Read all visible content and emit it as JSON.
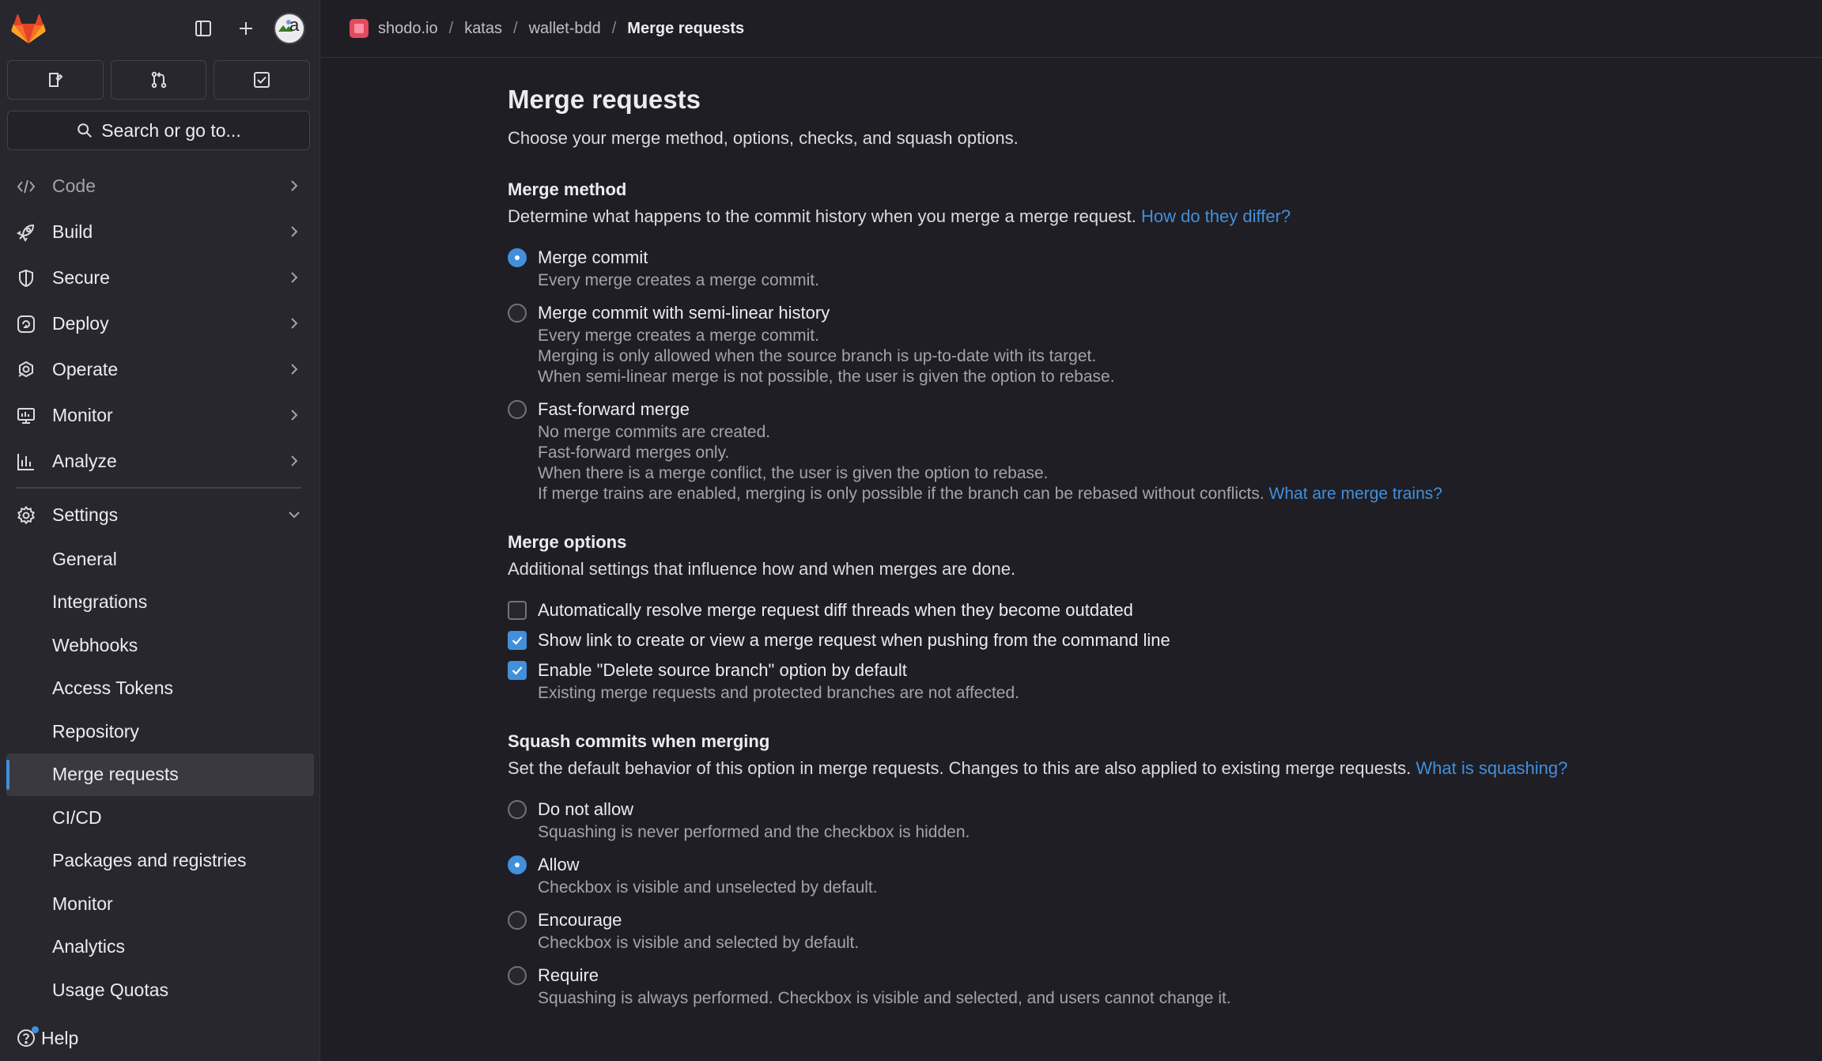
{
  "sidebar": {
    "avatar_alt": "a",
    "search_label": "Search or go to...",
    "nav": [
      {
        "label": "Code",
        "icon": "code-icon"
      },
      {
        "label": "Build",
        "icon": "rocket-icon"
      },
      {
        "label": "Secure",
        "icon": "shield-icon"
      },
      {
        "label": "Deploy",
        "icon": "deploy-icon"
      },
      {
        "label": "Operate",
        "icon": "operate-icon"
      },
      {
        "label": "Monitor",
        "icon": "monitor-icon"
      },
      {
        "label": "Analyze",
        "icon": "chart-icon"
      }
    ],
    "settings_label": "Settings",
    "settings_items": [
      "General",
      "Integrations",
      "Webhooks",
      "Access Tokens",
      "Repository",
      "Merge requests",
      "CI/CD",
      "Packages and registries",
      "Monitor",
      "Analytics",
      "Usage Quotas"
    ],
    "active_item": "Merge requests",
    "help_label": "Help"
  },
  "breadcrumb": [
    "shodo.io",
    "katas",
    "wallet-bdd",
    "Merge requests"
  ],
  "page": {
    "title": "Merge requests",
    "description": "Choose your merge method, options, checks, and squash options."
  },
  "merge_method": {
    "title": "Merge method",
    "description": "Determine what happens to the commit history when you merge a merge request.",
    "link": "How do they differ?",
    "options": [
      {
        "label": "Merge commit",
        "selected": true,
        "help": [
          "Every merge creates a merge commit."
        ]
      },
      {
        "label": "Merge commit with semi-linear history",
        "selected": false,
        "help": [
          "Every merge creates a merge commit.",
          "Merging is only allowed when the source branch is up-to-date with its target.",
          "When semi-linear merge is not possible, the user is given the option to rebase."
        ]
      },
      {
        "label": "Fast-forward merge",
        "selected": false,
        "help": [
          "No merge commits are created.",
          "Fast-forward merges only.",
          "When there is a merge conflict, the user is given the option to rebase.",
          "If merge trains are enabled, merging is only possible if the branch can be rebased without conflicts."
        ],
        "link": "What are merge trains?"
      }
    ]
  },
  "merge_options": {
    "title": "Merge options",
    "description": "Additional settings that influence how and when merges are done.",
    "options": [
      {
        "label": "Automatically resolve merge request diff threads when they become outdated",
        "checked": false
      },
      {
        "label": "Show link to create or view a merge request when pushing from the command line",
        "checked": true
      },
      {
        "label": "Enable \"Delete source branch\" option by default",
        "checked": true,
        "help": "Existing merge requests and protected branches are not affected."
      }
    ]
  },
  "squash": {
    "title": "Squash commits when merging",
    "description": "Set the default behavior of this option in merge requests. Changes to this are also applied to existing merge requests.",
    "link": "What is squashing?",
    "options": [
      {
        "label": "Do not allow",
        "selected": false,
        "help": "Squashing is never performed and the checkbox is hidden."
      },
      {
        "label": "Allow",
        "selected": true,
        "help": "Checkbox is visible and unselected by default."
      },
      {
        "label": "Encourage",
        "selected": false,
        "help": "Checkbox is visible and selected by default."
      },
      {
        "label": "Require",
        "selected": false,
        "help": "Squashing is always performed. Checkbox is visible and selected, and users cannot change it."
      }
    ]
  },
  "colors": {
    "accent": "#428fdc",
    "bg": "#1f1e24",
    "sidebar": "#28272d"
  }
}
